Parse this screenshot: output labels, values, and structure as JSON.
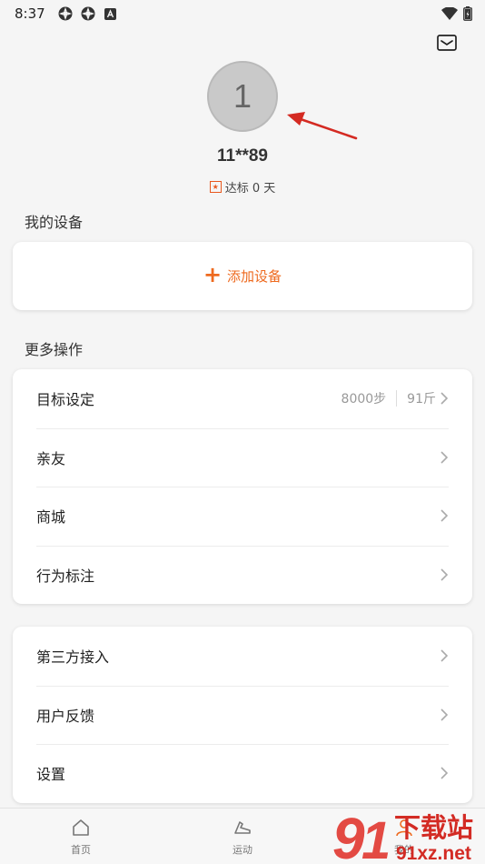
{
  "status_bar": {
    "time": "8:37"
  },
  "profile": {
    "avatar_text": "1",
    "username": "11**89",
    "goal_badge": "★",
    "goal_text": "达标 0 天"
  },
  "devices": {
    "section_title": "我的设备",
    "add_label": "添加设备"
  },
  "more": {
    "section_title": "更多操作",
    "items": [
      {
        "label": "目标设定",
        "steps": "8000步",
        "weight": "91斤"
      },
      {
        "label": "亲友"
      },
      {
        "label": "商城"
      },
      {
        "label": "行为标注"
      }
    ]
  },
  "settings": {
    "items": [
      {
        "label": "第三方接入"
      },
      {
        "label": "用户反馈"
      },
      {
        "label": "设置"
      }
    ]
  },
  "bottom_nav": {
    "items": [
      {
        "label": "首页",
        "icon": "home-icon"
      },
      {
        "label": "运动",
        "icon": "shoe-icon"
      },
      {
        "label": "我的",
        "icon": "person-icon"
      }
    ]
  },
  "watermark": {
    "text1": "下载站",
    "text2": "91xz.net"
  },
  "colors": {
    "accent": "#ee6a1f",
    "annotation_arrow": "#d42a22"
  }
}
